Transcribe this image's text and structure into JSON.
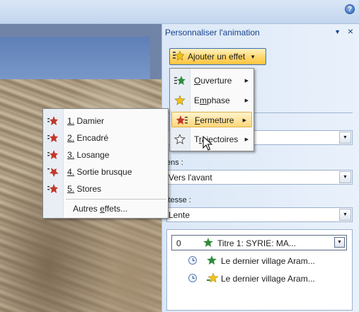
{
  "help": {
    "glyph": "?"
  },
  "pane": {
    "title": "Personnaliser l'animation",
    "menu_glyph": "▼",
    "close_glyph": "×",
    "add_effect_label": "Ajouter un effet",
    "add_effect_arrow": "▼",
    "sens_label": "ens :",
    "sens_value": "Vers l'avant",
    "vitesse_label": "itesse :",
    "vitesse_value": "Lente",
    "top_combo_value": "",
    "combo_glyph": "▼"
  },
  "anim_list": {
    "rows": [
      {
        "index": "0",
        "text": "Titre 1: SYRIE:  MA...",
        "selected": true
      },
      {
        "index": "",
        "text": "Le dernier village Aram..."
      },
      {
        "index": "",
        "text": "Le dernier village Aram..."
      }
    ]
  },
  "effect_menu": {
    "items": [
      {
        "label": "Ouverture",
        "mnemonic": "O",
        "rest": "uverture",
        "icon": "entrance-star-icon",
        "color": "#2e8b3a"
      },
      {
        "label": "Emphase",
        "mnemonic": "m",
        "prefix": "E",
        "rest": "phase",
        "icon": "emphasis-star-icon",
        "color": "#e0b020"
      },
      {
        "label": "Fermeture",
        "mnemonic": "F",
        "rest": "ermeture",
        "icon": "exit-star-icon",
        "color": "#c0392b"
      },
      {
        "label": "Trajectoires",
        "mnemonic": "r",
        "prefix": "T",
        "rest": "ajectoires",
        "icon": "motion-path-star-icon",
        "color": "#555555"
      }
    ]
  },
  "exit_menu": {
    "items": [
      {
        "num": "1.",
        "label": "Damier"
      },
      {
        "num": "2.",
        "label": "Encadré"
      },
      {
        "num": "3.",
        "label": "Losange"
      },
      {
        "num": "4.",
        "label": "Sortie brusque"
      },
      {
        "num": "5.",
        "label": "Stores"
      }
    ],
    "more_prefix": "Autres ",
    "more_mnemonic": "e",
    "more_rest": "ffets..."
  },
  "colors": {
    "accent": "#15428b",
    "hover": "#ffd77a",
    "exit_icon": "#c0392b"
  }
}
